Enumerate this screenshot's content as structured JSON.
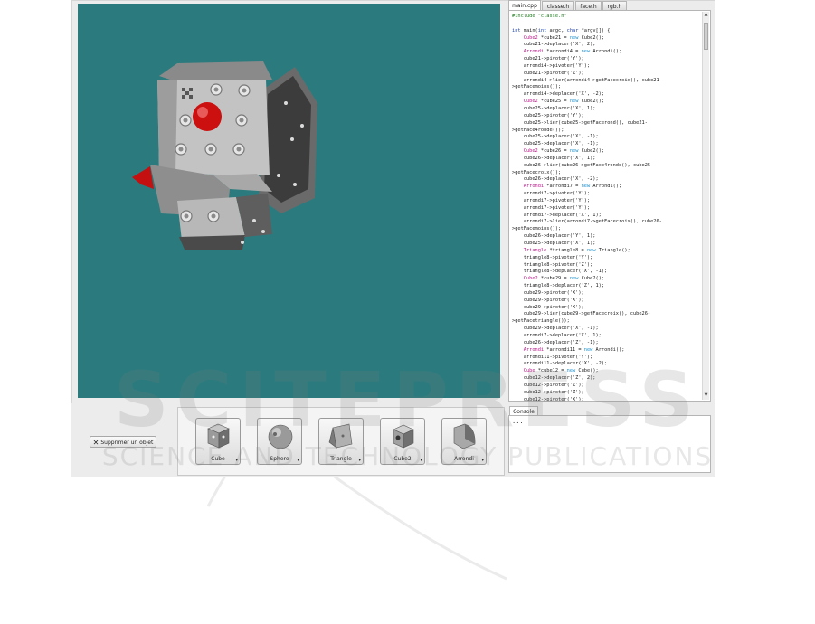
{
  "tabs": [
    {
      "label": "main.cpp",
      "active": true
    },
    {
      "label": "classe.h",
      "active": false
    },
    {
      "label": "face.h",
      "active": false
    },
    {
      "label": "rgb.h",
      "active": false
    }
  ],
  "delete_button": {
    "label": "Supprimer un objet"
  },
  "tools": [
    {
      "label": "Cube",
      "icon": "cube-icon"
    },
    {
      "label": "Sphere",
      "icon": "sphere-icon"
    },
    {
      "label": "Triangle",
      "icon": "triangle-icon"
    },
    {
      "label": "Cube2",
      "icon": "cube2-icon"
    },
    {
      "label": "Arrondi",
      "icon": "arrondi-icon"
    }
  ],
  "console": {
    "tab_label": "Console",
    "text": "..."
  },
  "watermark": {
    "line1": "SCITEPRESS",
    "line2": "SCIENCE AND TECHNOLOGY PUBLICATIONS"
  },
  "colors": {
    "viewport_bg": "#2b7b7e",
    "keyword": "#1a3fa8",
    "type": "#c0148c",
    "new": "#1a8fd0",
    "preprocessor": "#1b7a1b"
  },
  "code_lines": [
    [
      [
        "pp",
        "#include \"classe.h\""
      ]
    ],
    [
      [
        "t",
        ""
      ]
    ],
    [
      [
        "kw",
        "int"
      ],
      [
        "t",
        " main("
      ],
      [
        "kw",
        "int"
      ],
      [
        "t",
        " argc, "
      ],
      [
        "kw",
        "char"
      ],
      [
        "t",
        " *argv[]) {"
      ]
    ],
    [
      [
        "t",
        "    "
      ],
      [
        "ty",
        "Cube2"
      ],
      [
        "t",
        " *cube21 = "
      ],
      [
        "nw",
        "new"
      ],
      [
        "t",
        " Cube2();"
      ]
    ],
    [
      [
        "t",
        "    cube21->deplacer('X', 2);"
      ]
    ],
    [
      [
        "t",
        "    "
      ],
      [
        "ty",
        "Arrondi"
      ],
      [
        "t",
        " *arrondi4 = "
      ],
      [
        "nw",
        "new"
      ],
      [
        "t",
        " Arrondi();"
      ]
    ],
    [
      [
        "t",
        "    cube21->pivoter('Y');"
      ]
    ],
    [
      [
        "t",
        "    arrondi4->pivoter('Y');"
      ]
    ],
    [
      [
        "t",
        "    cube21->pivoter('Z');"
      ]
    ],
    [
      [
        "t",
        "    arrondi4->lier(arrondi4->getFacecroix(), cube21-"
      ]
    ],
    [
      [
        "t",
        ">getFacemoins());"
      ]
    ],
    [
      [
        "t",
        "    arrondi4->deplacer('X', -2);"
      ]
    ],
    [
      [
        "t",
        "    "
      ],
      [
        "ty",
        "Cube2"
      ],
      [
        "t",
        " *cube25 = "
      ],
      [
        "nw",
        "new"
      ],
      [
        "t",
        " Cube2();"
      ]
    ],
    [
      [
        "t",
        "    cube25->deplacer('X', 1);"
      ]
    ],
    [
      [
        "t",
        "    cube25->pivoter('Y');"
      ]
    ],
    [
      [
        "t",
        "    cube25->lier(cube25->getFacerond(), cube21-"
      ]
    ],
    [
      [
        "t",
        ">getFace4ronde());"
      ]
    ],
    [
      [
        "t",
        "    cube25->deplacer('X', -1);"
      ]
    ],
    [
      [
        "t",
        "    cube25->deplacer('X', -1);"
      ]
    ],
    [
      [
        "t",
        "    "
      ],
      [
        "ty",
        "Cube2"
      ],
      [
        "t",
        " *cube26 = "
      ],
      [
        "nw",
        "new"
      ],
      [
        "t",
        " Cube2();"
      ]
    ],
    [
      [
        "t",
        "    cube26->deplacer('X', 1);"
      ]
    ],
    [
      [
        "t",
        "    cube26->lier(cube26->getFace4ronde(), cube25-"
      ]
    ],
    [
      [
        "t",
        ">getFacecroix());"
      ]
    ],
    [
      [
        "t",
        "    cube26->deplacer('X', -2);"
      ]
    ],
    [
      [
        "t",
        "    "
      ],
      [
        "ty",
        "Arrondi"
      ],
      [
        "t",
        " *arrondi7 = "
      ],
      [
        "nw",
        "new"
      ],
      [
        "t",
        " Arrondi();"
      ]
    ],
    [
      [
        "t",
        "    arrondi7->pivoter('Y');"
      ]
    ],
    [
      [
        "t",
        "    arrondi7->pivoter('Y');"
      ]
    ],
    [
      [
        "t",
        "    arrondi7->pivoter('Y');"
      ]
    ],
    [
      [
        "t",
        "    arrondi7->deplacer('X', 1);"
      ]
    ],
    [
      [
        "t",
        "    arrondi7->lier(arrondi7->getFacecroix(), cube26-"
      ]
    ],
    [
      [
        "t",
        ">getFacemoins());"
      ]
    ],
    [
      [
        "t",
        "    cube26->deplacer('Y', 1);"
      ]
    ],
    [
      [
        "t",
        "    cube25->deplacer('X', 1);"
      ]
    ],
    [
      [
        "t",
        "    "
      ],
      [
        "ty",
        "Triangle"
      ],
      [
        "t",
        " *triangle8 = "
      ],
      [
        "nw",
        "new"
      ],
      [
        "t",
        " Triangle();"
      ]
    ],
    [
      [
        "t",
        "    triangle8->pivoter('Y');"
      ]
    ],
    [
      [
        "t",
        "    triangle8->pivoter('Z');"
      ]
    ],
    [
      [
        "t",
        "    triangle8->deplacer('X', -1);"
      ]
    ],
    [
      [
        "t",
        "    "
      ],
      [
        "ty",
        "Cube2"
      ],
      [
        "t",
        " *cube29 = "
      ],
      [
        "nw",
        "new"
      ],
      [
        "t",
        " Cube2();"
      ]
    ],
    [
      [
        "t",
        "    triangle8->deplacer('Z', 1);"
      ]
    ],
    [
      [
        "t",
        "    cube29->pivoter('X');"
      ]
    ],
    [
      [
        "t",
        "    cube29->pivoter('X');"
      ]
    ],
    [
      [
        "t",
        "    cube29->pivoter('X');"
      ]
    ],
    [
      [
        "t",
        "    cube29->lier(cube29->getFacecroix(), cube26-"
      ]
    ],
    [
      [
        "t",
        ">getFacetriangle());"
      ]
    ],
    [
      [
        "t",
        "    cube29->deplacer('X', -1);"
      ]
    ],
    [
      [
        "t",
        "    arrondi7->deplacer('X', 1);"
      ]
    ],
    [
      [
        "t",
        "    cube26->deplacer('Z', -1);"
      ]
    ],
    [
      [
        "t",
        "    "
      ],
      [
        "ty",
        "Arrondi"
      ],
      [
        "t",
        " *arrondi11 = "
      ],
      [
        "nw",
        "new"
      ],
      [
        "t",
        " Arrondi();"
      ]
    ],
    [
      [
        "t",
        "    arrondi11->pivoter('Y');"
      ]
    ],
    [
      [
        "t",
        "    arrondi11->deplacer('X', -2);"
      ]
    ],
    [
      [
        "t",
        "    "
      ],
      [
        "ty",
        "Cube"
      ],
      [
        "t",
        " *cube12 = "
      ],
      [
        "nw",
        "new"
      ],
      [
        "t",
        " Cube();"
      ]
    ],
    [
      [
        "t",
        "    cube12->deplacer('Z', 2);"
      ]
    ],
    [
      [
        "t",
        "    cube12->pivoter('Z');"
      ]
    ],
    [
      [
        "t",
        "    cube12->pivoter('Z');"
      ]
    ],
    [
      [
        "t",
        "    cube12->pivoter('X');"
      ]
    ]
  ]
}
